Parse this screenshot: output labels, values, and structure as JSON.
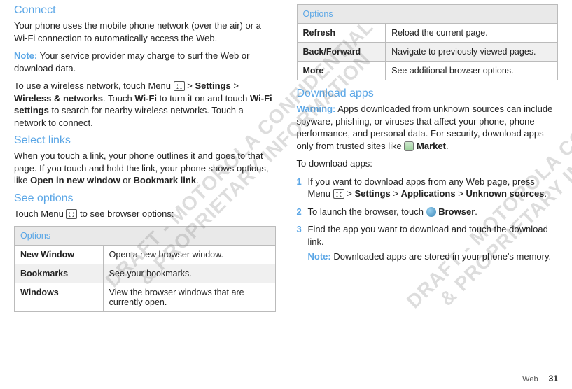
{
  "watermarks": {
    "left": "DRAFT - MOTOROLA CONFIDENTIAL\n& PROPRIETARY INFORMATION",
    "right": "DRAFT - MOTOROLA CONFIDENTIAL\n& PROPRIETARY INFORMATION"
  },
  "left": {
    "connect": {
      "heading": "Connect",
      "p1": "Your phone uses the mobile phone network (over the air) or a Wi-Fi connection to automatically access the Web.",
      "note_label": "Note:",
      "note_text": " Your service provider may charge to surf the Web or download data.",
      "p3a": "To use a wireless network, touch Menu ",
      "p3b": " > ",
      "p3_settings": "Settings",
      "p3c": " > ",
      "p3_wireless": "Wireless & networks",
      "p3d": ". Touch ",
      "p3_wifi": "Wi-Fi",
      "p3e": " to turn it on and touch ",
      "p3_wifisettings": "Wi-Fi settings",
      "p3f": " to search for nearby wireless networks. Touch a network to connect."
    },
    "select": {
      "heading": "Select links",
      "p1a": "When you touch a link, your phone outlines it and goes to that page. If you touch and hold the link, your phone shows options, like ",
      "open_new": "Open in new window",
      "p1b": " or ",
      "bookmark_link": "Bookmark link",
      "p1c": "."
    },
    "seeopts": {
      "heading": "See options",
      "intro_a": "Touch Menu ",
      "intro_b": " to see browser options:"
    },
    "table1": {
      "header": "Options",
      "rows": [
        {
          "k": "New Window",
          "v": "Open a new browser window."
        },
        {
          "k": "Bookmarks",
          "v": "See your bookmarks."
        },
        {
          "k": "Windows",
          "v": "View the browser windows that are currently open."
        }
      ]
    }
  },
  "right": {
    "table2": {
      "header": "Options",
      "rows": [
        {
          "k": "Refresh",
          "v": "Reload the current page."
        },
        {
          "k": "Back/Forward",
          "v": "Navigate to previously viewed pages."
        },
        {
          "k": "More",
          "v": "See additional browser options."
        }
      ]
    },
    "download": {
      "heading": "Download apps",
      "warn_label": "Warning:",
      "warn_text_a": " Apps downloaded from unknown sources can include spyware, phishing, or viruses that affect your phone, phone performance, and personal data. For security, download apps only from trusted sites like ",
      "market": "Market",
      "warn_text_b": ".",
      "intro": "To download apps:",
      "steps": {
        "s1a": "If you want to download apps from any Web page, press Menu ",
        "s1b": " > ",
        "s1_settings": "Settings",
        "s1c": " > ",
        "s1_apps": "Applications",
        "s1d": " > ",
        "s1_unknown": "Unknown sources",
        "s1e": ".",
        "s2a": "To launch the browser, touch ",
        "s2_browser": "Browser",
        "s2b": ".",
        "s3": "Find the app you want to download and touch the download link.",
        "s3_note_label": "Note:",
        "s3_note_text": " Downloaded apps are stored in your phone's memory."
      }
    }
  },
  "footer": {
    "section": "Web",
    "page": "31"
  }
}
